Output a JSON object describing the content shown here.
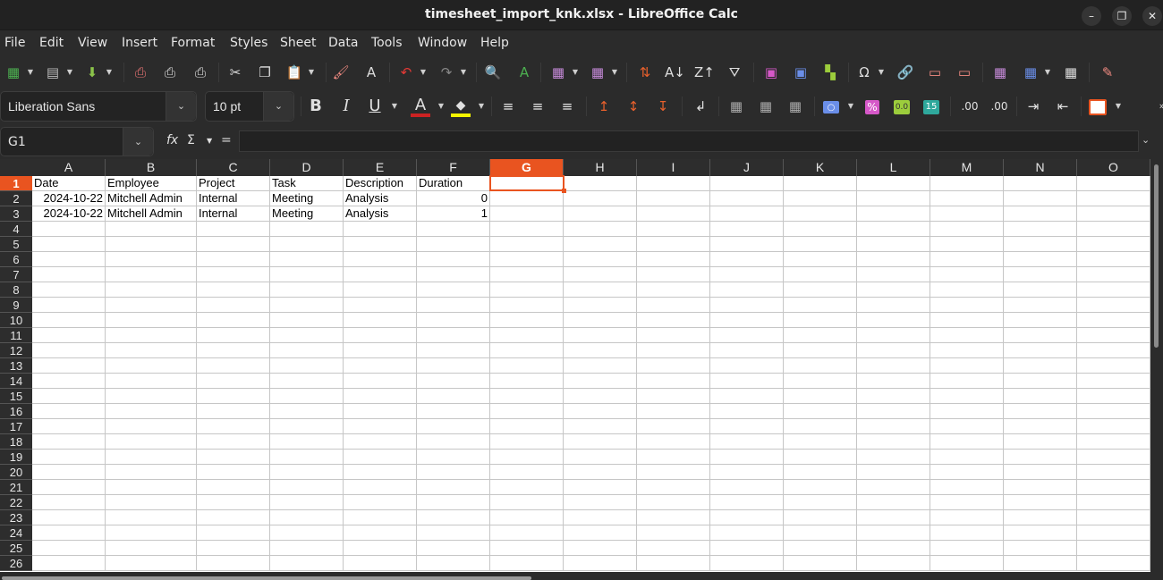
{
  "window": {
    "title": "timesheet_import_knk.xlsx - LibreOffice Calc",
    "minimize_glyph": "–",
    "maximize_glyph": "❐",
    "close_glyph": "✕"
  },
  "menu": [
    "File",
    "Edit",
    "View",
    "Insert",
    "Format",
    "Styles",
    "Sheet",
    "Data",
    "Tools",
    "Window",
    "Help"
  ],
  "toolbar_standard": [
    {
      "name": "new-spreadsheet-icon",
      "glyph": "▦"
    },
    {
      "name": "open-icon",
      "glyph": "▤"
    },
    {
      "name": "save-icon",
      "glyph": "⬇"
    },
    {
      "name": "export-pdf-icon",
      "glyph": "⎙"
    },
    {
      "name": "print-icon",
      "glyph": "⎙"
    },
    {
      "name": "print-preview-icon",
      "glyph": "⎙"
    },
    {
      "name": "cut-icon",
      "glyph": "✂"
    },
    {
      "name": "copy-icon",
      "glyph": "❐"
    },
    {
      "name": "paste-icon",
      "glyph": "📋"
    },
    {
      "name": "clone-formatting-icon",
      "glyph": "🖌"
    },
    {
      "name": "clear-formatting-icon",
      "glyph": "A"
    },
    {
      "name": "undo-icon",
      "glyph": "↶"
    },
    {
      "name": "redo-icon",
      "glyph": "↷"
    },
    {
      "name": "find-replace-icon",
      "glyph": "🔍"
    },
    {
      "name": "spelling-icon",
      "glyph": "A"
    },
    {
      "name": "row-icon",
      "glyph": "▦"
    },
    {
      "name": "column-icon",
      "glyph": "▦"
    },
    {
      "name": "sort-icon",
      "glyph": "⇅"
    },
    {
      "name": "sort-ascending-icon",
      "glyph": "A↓"
    },
    {
      "name": "sort-descending-icon",
      "glyph": "Z↑"
    },
    {
      "name": "autofilter-icon",
      "glyph": "⛛"
    },
    {
      "name": "insert-image-icon",
      "glyph": "▣"
    },
    {
      "name": "insert-chart-icon",
      "glyph": "▣"
    },
    {
      "name": "pivot-table-icon",
      "glyph": "▚"
    },
    {
      "name": "special-character-icon",
      "glyph": "Ω"
    },
    {
      "name": "hyperlink-icon",
      "glyph": "🔗"
    },
    {
      "name": "comment-icon",
      "glyph": "▭"
    },
    {
      "name": "header-footer-icon",
      "glyph": "▭"
    },
    {
      "name": "define-print-area-icon",
      "glyph": "▦"
    },
    {
      "name": "freeze-rows-columns-icon",
      "glyph": "▦"
    },
    {
      "name": "split-window-icon",
      "glyph": "▦"
    },
    {
      "name": "show-draw-functions-icon",
      "glyph": "✎"
    }
  ],
  "formatting": {
    "font_name": "Liberation Sans",
    "font_size": "10 pt",
    "font_color": "#cc2222",
    "highlight_color": "#f5f500",
    "bold_glyph": "B",
    "italic_glyph": "I",
    "underline_glyph": "U",
    "font_color_glyph": "A",
    "highlight_glyph": "◆",
    "percent_glyph": "%",
    "number_glyph": "0.0",
    "date_glyph": "15",
    "currency_glyph": "○"
  },
  "formula_bar": {
    "cell_reference": "G1",
    "formula_value": "",
    "function_wizard_glyph": "fx",
    "sum_glyph": "Σ",
    "formula_glyph": "="
  },
  "accent_color": "#e95420",
  "columns": [
    "A",
    "B",
    "C",
    "D",
    "E",
    "F",
    "G",
    "H",
    "I",
    "J",
    "K",
    "L",
    "M",
    "N",
    "O"
  ],
  "selected_column": "G",
  "selected_row": 1,
  "row_count": 26,
  "rows": [
    [
      {
        "v": "Date"
      },
      {
        "v": "Employee"
      },
      {
        "v": "Project"
      },
      {
        "v": "Task"
      },
      {
        "v": "Description"
      },
      {
        "v": "Duration"
      }
    ],
    [
      {
        "v": "2024-10-22",
        "num": true
      },
      {
        "v": "Mitchell Admin"
      },
      {
        "v": "Internal"
      },
      {
        "v": "Meeting"
      },
      {
        "v": "Analysis"
      },
      {
        "v": "0",
        "num": true
      }
    ],
    [
      {
        "v": "2024-10-22",
        "num": true
      },
      {
        "v": "Mitchell Admin"
      },
      {
        "v": "Internal"
      },
      {
        "v": "Meeting"
      },
      {
        "v": "Analysis"
      },
      {
        "v": "1",
        "num": true
      }
    ]
  ]
}
